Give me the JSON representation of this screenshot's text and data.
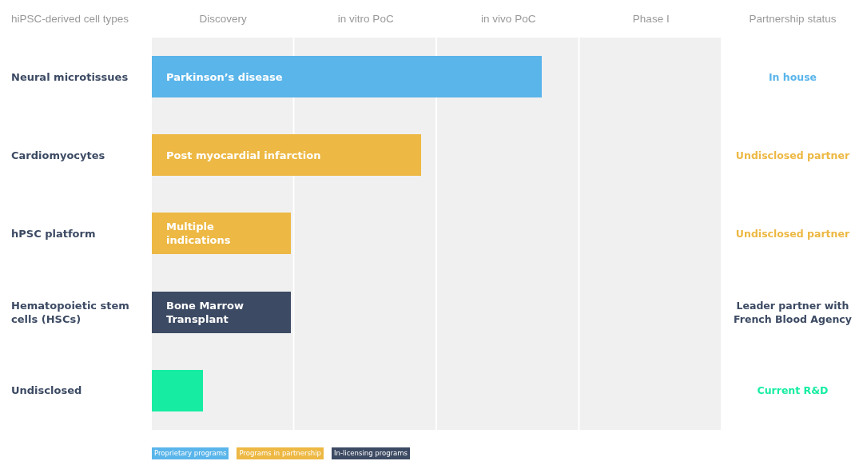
{
  "header": {
    "label_column": "hiPSC-derived cell types",
    "stages": [
      "Discovery",
      "in vitro PoC",
      "in vivo PoC",
      "Phase I"
    ],
    "status_column": "Partnership status"
  },
  "programs": [
    {
      "cell_type": "Neural microtissues",
      "indication": "Parkinson’s disease",
      "level": 0.684,
      "color": "#5ab5ea",
      "status": "In house"
    },
    {
      "cell_type": "Cardiomyocytes",
      "indication": "Post myocardial infarction",
      "level": 0.472,
      "color": "#edb843",
      "status": "Undisclosed partner"
    },
    {
      "cell_type": "hPSC platform",
      "indication": "Multiple indications",
      "level": 0.244,
      "color": "#edb843",
      "status": "Undisclosed partner"
    },
    {
      "cell_type": "Hematopoietic stem cells (HSCs)",
      "indication": "Bone Marrow Transplant",
      "level": 0.244,
      "color": "#3c4a63",
      "status": "Leader partner with French Blood Agency"
    },
    {
      "cell_type": "Undisclosed",
      "level": 0.09,
      "color": "#16eda2",
      "status": "Current R&D"
    }
  ],
  "legend": [
    {
      "label": "Proprietary programs",
      "color": "#5ab5ea"
    },
    {
      "label": "Programs in partnership",
      "color": "#edb843"
    },
    {
      "label": "In-licensing programs",
      "color": "#3c4a63"
    }
  ]
}
